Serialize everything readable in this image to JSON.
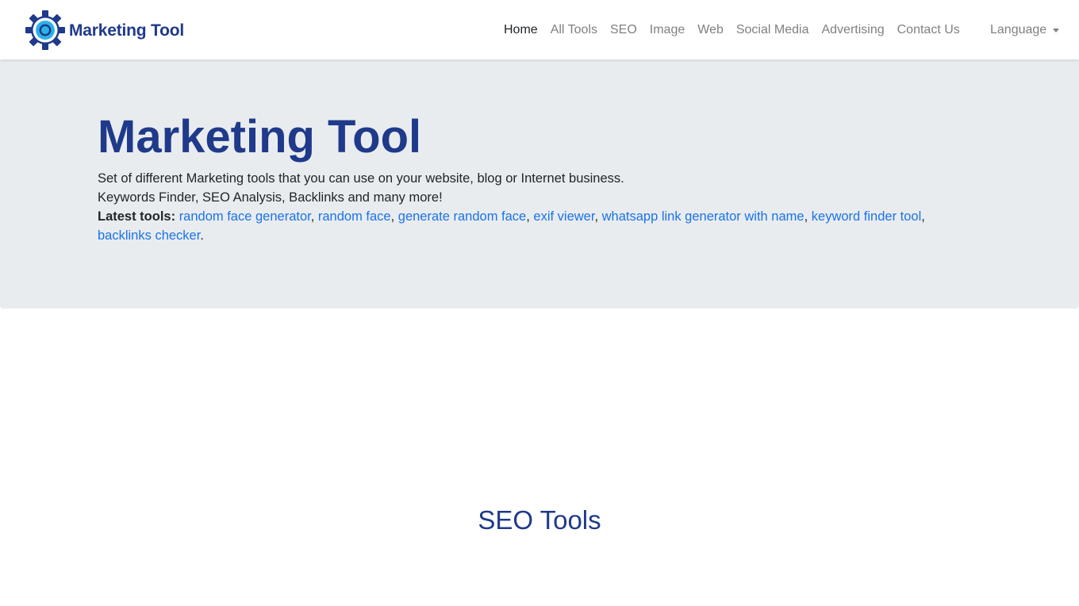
{
  "brand": {
    "name": "Marketing Tool",
    "logo_icon": "gear-logo-icon",
    "color": "#1f3a8a",
    "accent": "#2bb3e8"
  },
  "nav": {
    "items": [
      {
        "label": "Home",
        "active": true
      },
      {
        "label": "All Tools"
      },
      {
        "label": "SEO"
      },
      {
        "label": "Image"
      },
      {
        "label": "Web"
      },
      {
        "label": "Social Media"
      },
      {
        "label": "Advertising"
      },
      {
        "label": "Contact Us"
      }
    ],
    "language_label": "Language",
    "language_icon": "caret-down-icon"
  },
  "hero": {
    "title": "Marketing Tool",
    "line1": "Set of different Marketing tools that you can use on your website, blog or Internet business.",
    "line2": "Keywords Finder, SEO Analysis, Backlinks and many more!",
    "latest_label": "Latest tools:",
    "latest_links": [
      "random face generator",
      "random face",
      "generate random face",
      "exif viewer",
      "whatsapp link generator with name",
      "keyword finder tool",
      "backlinks checker"
    ],
    "background": "#e9ecef",
    "link_color": "#1a73e8"
  },
  "sections": {
    "seo_title": "SEO Tools"
  }
}
